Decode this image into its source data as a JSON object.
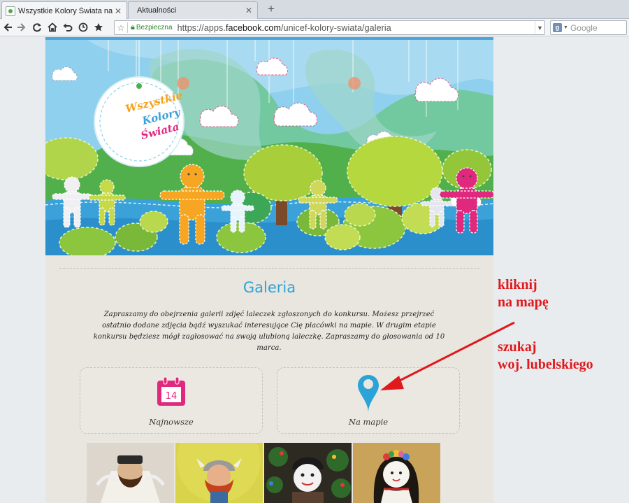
{
  "browser": {
    "tabs": [
      {
        "label": "Wszystkie Kolory Świata na Fac...",
        "active": true
      },
      {
        "label": "Aktualności",
        "active": false
      }
    ],
    "url": {
      "secure_label": "Bezpieczna",
      "prefix": "https://apps.",
      "domain": "facebook.com",
      "path": "/unicef-kolory-swiata/galeria"
    },
    "search_placeholder": "Google"
  },
  "banner": {
    "logo_lines": [
      "Wszystkie",
      "Kolory",
      "Świata"
    ]
  },
  "gallery": {
    "title": "Galeria",
    "intro": "Zapraszamy do obejrzenia galerii zdjęć laleczek zgłoszonych do konkursu. Możesz przejrzeć ostatnio dodane zdjęcia bądź wyszukać interesujące Cię placówki na mapie. W drugim etapie konkursu będziesz mógł zagłosować na swoją ulubioną laleczkę. Zapraszamy do głosowania od 10 marca.",
    "cards": [
      {
        "label": "Najnowsze",
        "icon_text": "14",
        "icon": "calendar-icon"
      },
      {
        "label": "Na mapie",
        "icon": "map-pin-icon"
      }
    ]
  },
  "annotation": {
    "line1": "kliknij",
    "line2": "na mapę",
    "line3": "szukaj",
    "line4": "woj. lubelskiego"
  },
  "colors": {
    "accent_blue": "#2aa4d8",
    "calendar_pink": "#e0297e",
    "annotation_red": "#e0191c"
  }
}
